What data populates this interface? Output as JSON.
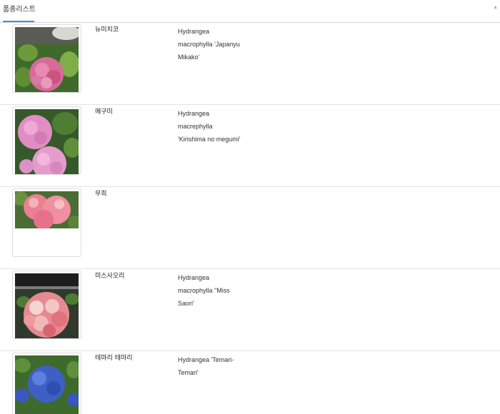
{
  "tabs": [
    {
      "label": "품종리스트",
      "active": true
    }
  ],
  "accent_color": "#4c8fd6",
  "varieties": [
    {
      "name": "뉴미치코",
      "scientific_lines": [
        "Hydrangea",
        "macrophylla 'Japanyu",
        "Mikako'"
      ],
      "flower_color": "pink"
    },
    {
      "name": "메구미",
      "scientific_lines": [
        "Hydrangea",
        "macrephylla",
        "'Kirishima no megumi'"
      ],
      "flower_color": "pink"
    },
    {
      "name": "무희",
      "scientific_lines": [],
      "flower_color": "coral-pink"
    },
    {
      "name": "미스사오리",
      "scientific_lines": [
        "Hydrangea",
        "macrophylla \"Miss",
        "Saori'"
      ],
      "flower_color": "pink-white"
    },
    {
      "name": "테마리 테마리",
      "scientific_lines": [
        "Hydrangea 'Temari-",
        "Temari'"
      ],
      "flower_color": "blue"
    }
  ]
}
